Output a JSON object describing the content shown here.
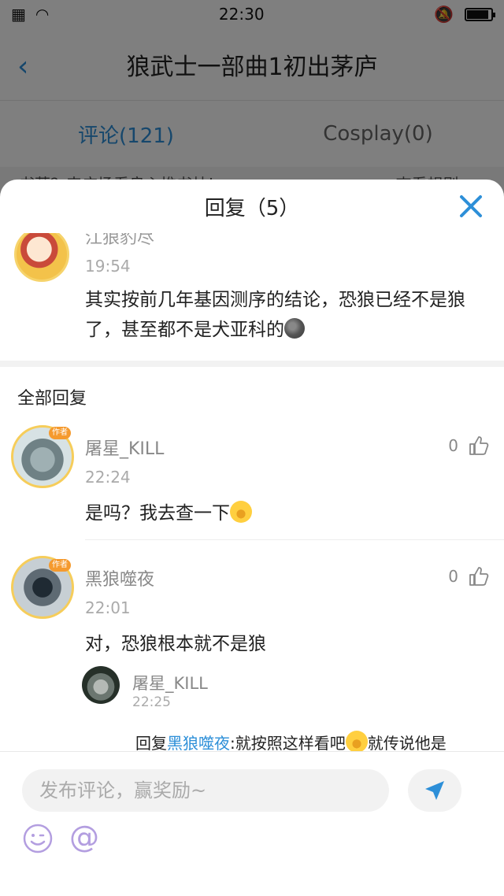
{
  "status_bar": {
    "time": "22:30",
    "battery_level": 0.9
  },
  "background_page": {
    "title": "狼武士一部曲1初出茅庐",
    "tabs": [
      "评论(121)",
      "Cosplay(0)"
    ],
    "notice_left": "书荒？来广场看良心推书帖!",
    "notice_right": "查看规则>>"
  },
  "sheet": {
    "title": "回复（5）",
    "original_comment": {
      "name": "江狼豹尽",
      "time": "19:54",
      "text": "其实按前几年基因测序的结论，恐狼已经不是狼了，甚至都不是犬亚科的"
    },
    "section_label": "全部回复",
    "replies": [
      {
        "name": "屠星_KILL",
        "time": "22:24",
        "text": "是吗？我去查一下",
        "likes": "0",
        "badge": "作者"
      },
      {
        "name": "黑狼噬夜",
        "time": "22:01",
        "text": "对，恐狼根本就不是狼",
        "likes": "0",
        "badge": "作者",
        "sub_reply": {
          "name": "屠星_KILL",
          "time": "22:25",
          "prefix": "回复",
          "mention": "黑狼噬夜",
          "text": ":就按照这样看吧",
          "text_tail": "就传说他是"
        }
      }
    ]
  },
  "input": {
    "placeholder": "发布评论，赢奖励~"
  },
  "colors": {
    "accent": "#2d8fd8",
    "emoji_purple": "#b39ee0"
  }
}
